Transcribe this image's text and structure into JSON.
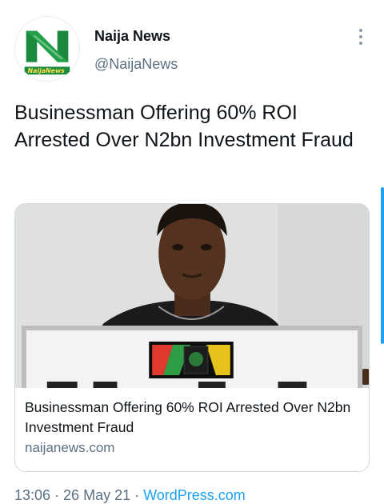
{
  "author": {
    "display_name": "Naija News",
    "handle": "@NaijaNews",
    "avatar_label": "NaijaNews"
  },
  "tweet": {
    "text": "Businessman Offering 60% ROI Arrested Over N2bn Investment Fraud"
  },
  "card": {
    "title": "Businessman Offering 60% ROI Arrested Over N2bn Investment Fraud",
    "domain": "naijanews.com"
  },
  "meta": {
    "time": "13:06",
    "separator1": " · ",
    "date": "26 May 21",
    "separator2": " · ",
    "source": "WordPress.com"
  },
  "colors": {
    "link": "#1da1f2",
    "secondary_text": "#5b7083",
    "brand_green": "#1b8a3c"
  },
  "icons": {
    "more": "more-vertical-icon"
  }
}
